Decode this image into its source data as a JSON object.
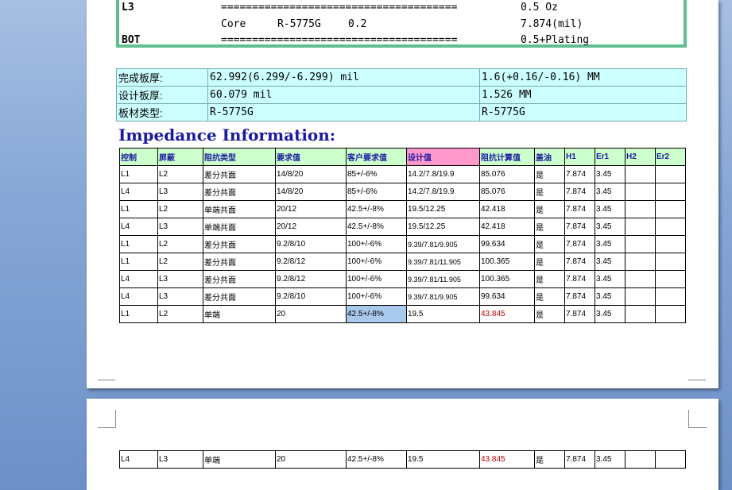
{
  "stackup": {
    "rows": [
      {
        "layer": "L3",
        "material": "",
        "value": "",
        "bar": "======================================",
        "thickness": "0.5 Oz"
      },
      {
        "layer": "",
        "material": "Core",
        "spec": "R-5775G",
        "value": "0.2",
        "bar": "",
        "thickness": "7.874(mil)"
      },
      {
        "layer": "BOT",
        "material": "",
        "value": "",
        "bar": "======================================",
        "thickness": "0.5+Plating"
      }
    ]
  },
  "specs": [
    {
      "label": "完成板厚:",
      "value_mil": "62.992(6.299/-6.299) mil",
      "value_mm": "1.6(+0.16/-0.16) MM"
    },
    {
      "label": "设计板厚:",
      "value_mil": "60.079 mil",
      "value_mm": "1.526 MM"
    },
    {
      "label": "板材类型:",
      "value_mil": "R-5775G",
      "value_mm": "R-5775G"
    }
  ],
  "impedance_title": "Impedance Information:",
  "impedance": {
    "headers": [
      "控制",
      "屏蔽",
      "阻抗类型",
      "要求值",
      "客户要求值",
      "设计值",
      "阻抗计算值",
      "盖油",
      "H1",
      "Er1",
      "H2",
      "Er2"
    ],
    "rows": [
      [
        "L1",
        "L2",
        "差分共面",
        "14/8/20",
        "85+/-6%",
        "14.2/7.8/19.9",
        "85.076",
        "是",
        "7.874",
        "3.45",
        "",
        ""
      ],
      [
        "L4",
        "L3",
        "差分共面",
        "14/8/20",
        "85+/-6%",
        "14.2/7.8/19.9",
        "85.076",
        "是",
        "7.874",
        "3.45",
        "",
        ""
      ],
      [
        "L1",
        "L2",
        "单端共面",
        "20/12",
        "42.5+/-8%",
        "19.5/12.25",
        "42.418",
        "是",
        "7.874",
        "3.45",
        "",
        ""
      ],
      [
        "L4",
        "L3",
        "单端共面",
        "20/12",
        "42.5+/-8%",
        "19.5/12.25",
        "42.418",
        "是",
        "7.874",
        "3.45",
        "",
        ""
      ],
      [
        "L1",
        "L2",
        "差分共面",
        "9.2/8/10",
        "100+/-6%",
        "9.39/7.81/9.905",
        "99.634",
        "是",
        "7.874",
        "3.45",
        "",
        ""
      ],
      [
        "L1",
        "L2",
        "差分共面",
        "9.2/8/12",
        "100+/-6%",
        "9.39/7.81/11.905",
        "100.365",
        "是",
        "7.874",
        "3.45",
        "",
        ""
      ],
      [
        "L4",
        "L3",
        "差分共面",
        "9.2/8/12",
        "100+/-6%",
        "9.39/7.81/11.905",
        "100.365",
        "是",
        "7.874",
        "3.45",
        "",
        ""
      ],
      [
        "L4",
        "L3",
        "差分共面",
        "9.2/8/10",
        "100+/-6%",
        "9.39/7.81/9.905",
        "99.634",
        "是",
        "7.874",
        "3.45",
        "",
        ""
      ],
      [
        "L1",
        "L2",
        "单端",
        "20",
        "42.5+/-8%",
        "19.5",
        "43.845",
        "是",
        "7.874",
        "3.45",
        "",
        ""
      ]
    ],
    "continued_rows": [
      [
        "L4",
        "L3",
        "单端",
        "20",
        "42.5+/-8%",
        "19.5",
        "43.845",
        "是",
        "7.874",
        "3.45",
        "",
        ""
      ]
    ]
  },
  "colors": {
    "heading_blue": "#1a1aa0",
    "header_green": "#ccffcc",
    "header_pink": "#ff99cc",
    "spec_cyan": "#ccffff",
    "calc_red": "#c00000",
    "selection": "#a8c8ec"
  }
}
